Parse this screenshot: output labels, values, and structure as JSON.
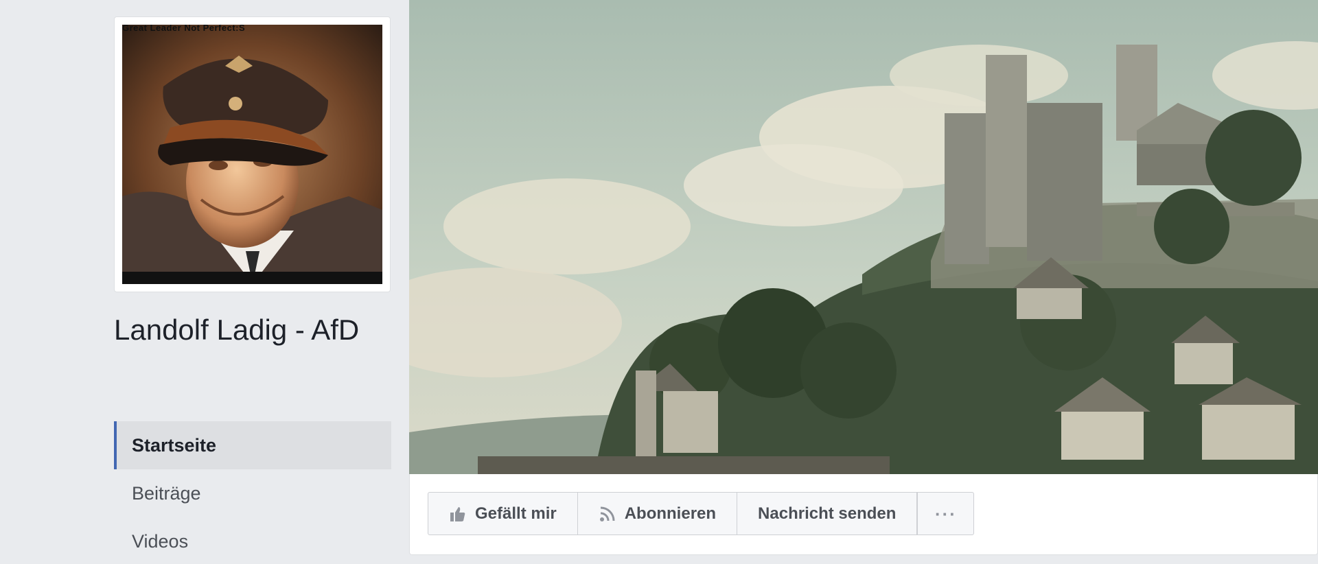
{
  "profile": {
    "photo_caption": "Great Leader Not Perfect:S",
    "name": "Landolf Ladig - AfD"
  },
  "nav": {
    "items": [
      {
        "label": "Startseite",
        "active": true
      },
      {
        "label": "Beiträge",
        "active": false
      },
      {
        "label": "Videos",
        "active": false
      }
    ]
  },
  "actions": {
    "like_label": "Gefällt mir",
    "like_icon": "thumbs-up-icon",
    "follow_label": "Abonnieren",
    "follow_icon": "rss-icon",
    "message_label": "Nachricht senden",
    "more_label": "···"
  },
  "colors": {
    "accent": "#4267b2",
    "background": "#e9ebee"
  }
}
